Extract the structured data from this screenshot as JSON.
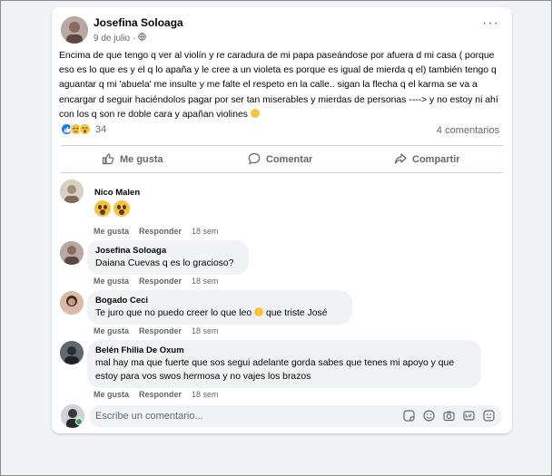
{
  "post": {
    "author": "Josefina Soloaga",
    "date": "9 de julio",
    "separator": "·",
    "text": "Encima de que tengo q ver al violín y re caradura de mi papa paseándose por afuera d mi casa ( porque eso es lo que es y el q lo apaña y le cree a un violeta es porque es igual de mierda q el) también tengo q aguantar q mi 'abuela' me insulte y me falte el respeto en la calle.. sigan la flecha q el karma se va a encargar d seguir haciéndolos pagar por ser tan miserables y mierdas de personas ----> y no estoy ni ahí con los q son re doble cara y apañan violines",
    "reaction_count": "34",
    "comments_count": "4 comentarios",
    "reactions": [
      "like-icon",
      "sad-icon",
      "wow-icon"
    ]
  },
  "actions": {
    "like": "Me gusta",
    "comment": "Comentar",
    "share": "Compartir"
  },
  "comments": [
    {
      "author": "Nico Malen",
      "text": "",
      "emoji": [
        "wow-icon",
        "wow-icon"
      ],
      "like": "Me gusta",
      "reply": "Responder",
      "time": "18 sem"
    },
    {
      "author": "Josefina Soloaga",
      "text": "Daiana Cuevas q es lo gracioso?",
      "like": "Me gusta",
      "reply": "Responder",
      "time": "18 sem"
    },
    {
      "author": "Bogado Ceci",
      "text": "Te juro que no puedo creer lo que leo",
      "text_after": "que triste José",
      "like": "Me gusta",
      "reply": "Responder",
      "time": "18 sem"
    },
    {
      "author": "Belén Fhilia De Oxum",
      "text": "mal hay ma que fuerte que sos segui adelante gorda sabes que tenes mi apoyo y que estoy para vos swos hermosa y no vajes los brazos",
      "like": "Me gusta",
      "reply": "Responder",
      "time": "18 sem"
    }
  ],
  "composer": {
    "placeholder": "Escribe un comentario..."
  },
  "colors": {
    "background": "#f0f2f5",
    "card": "#ffffff",
    "muted_text": "#65676b",
    "like_blue": "#1877f2",
    "online_green": "#31a24c"
  }
}
